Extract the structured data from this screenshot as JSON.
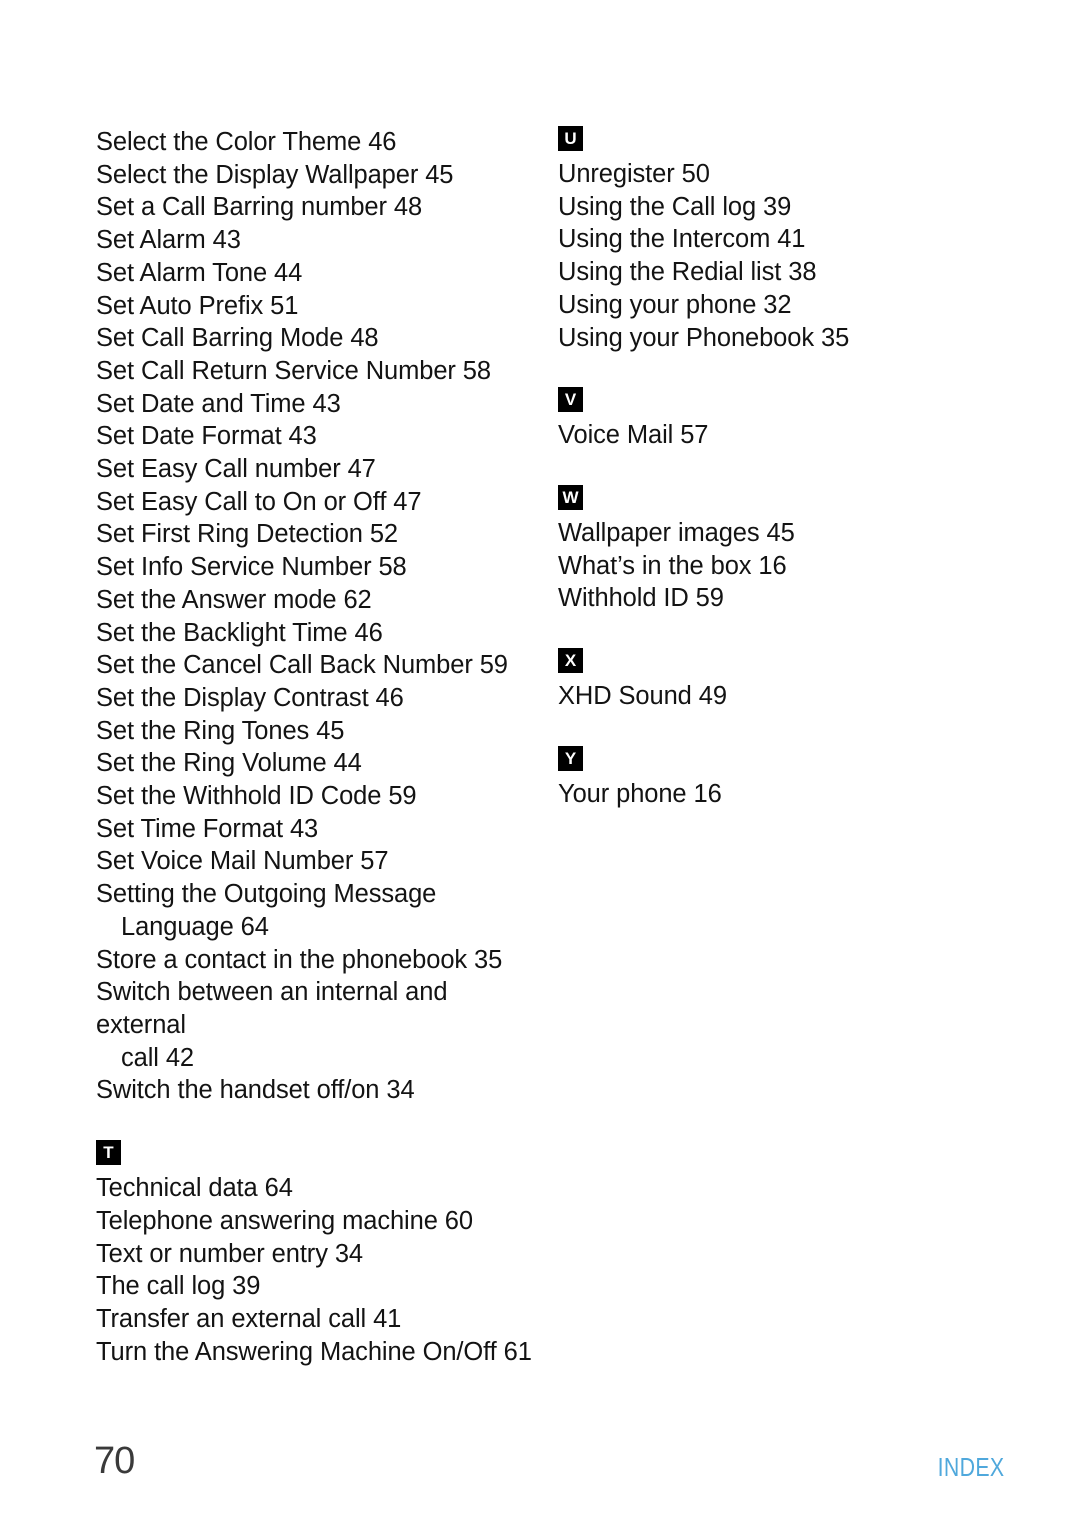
{
  "document": {
    "page_number": "70",
    "footer_label": "INDEX",
    "footer_label_color": "#4FA8DC",
    "badge_background_color": "#000000",
    "badge_text_color": "#FFFFFF",
    "text_color": "#131313"
  },
  "index": {
    "left_column": [
      {
        "letter": null,
        "entries": [
          {
            "text": "Select the Color Theme 46"
          },
          {
            "text": "Select the Display Wallpaper 45"
          },
          {
            "text": "Set a Call Barring number 48"
          },
          {
            "text": "Set Alarm 43"
          },
          {
            "text": "Set Alarm Tone 44"
          },
          {
            "text": "Set Auto Prefix 51"
          },
          {
            "text": "Set Call Barring Mode 48"
          },
          {
            "text": "Set Call Return Service Number 58"
          },
          {
            "text": "Set Date and Time 43"
          },
          {
            "text": "Set Date Format 43"
          },
          {
            "text": "Set Easy Call number 47"
          },
          {
            "text": "Set Easy Call to On or Off 47"
          },
          {
            "text": "Set First Ring Detection 52"
          },
          {
            "text": "Set Info Service Number 58"
          },
          {
            "text": "Set the Answer mode 62"
          },
          {
            "text": "Set the Backlight Time 46"
          },
          {
            "text": "Set the Cancel Call Back Number 59"
          },
          {
            "text": "Set the Display Contrast 46"
          },
          {
            "text": "Set the Ring Tones 45"
          },
          {
            "text": "Set the Ring Volume 44"
          },
          {
            "text": "Set the Withhold ID Code 59"
          },
          {
            "text": "Set Time Format 43"
          },
          {
            "text": "Set Voice Mail Number 57"
          },
          {
            "text": "Setting the Outgoing Message",
            "continuation": "Language 64"
          },
          {
            "text": "Store a contact in the phonebook 35"
          },
          {
            "text": "Switch between an internal and external",
            "continuation": "call 42"
          },
          {
            "text": "Switch the handset off/on 34"
          }
        ]
      },
      {
        "letter": "T",
        "entries": [
          {
            "text": "Technical data 64"
          },
          {
            "text": "Telephone answering machine 60"
          },
          {
            "text": "Text or number entry 34"
          },
          {
            "text": "The call log 39"
          },
          {
            "text": "Transfer an external call 41"
          },
          {
            "text": "Turn the Answering Machine On/Off 61"
          }
        ]
      }
    ],
    "right_column": [
      {
        "letter": "U",
        "entries": [
          {
            "text": "Unregister 50"
          },
          {
            "text": "Using the Call log 39"
          },
          {
            "text": "Using the Intercom 41"
          },
          {
            "text": "Using the Redial list 38"
          },
          {
            "text": "Using your phone 32"
          },
          {
            "text": "Using your Phonebook 35"
          }
        ]
      },
      {
        "letter": "V",
        "entries": [
          {
            "text": "Voice Mail 57"
          }
        ]
      },
      {
        "letter": "W",
        "entries": [
          {
            "text": "Wallpaper images 45"
          },
          {
            "text": "What’s in the box 16"
          },
          {
            "text": "Withhold ID 59"
          }
        ]
      },
      {
        "letter": "X",
        "entries": [
          {
            "text": "XHD Sound 49"
          }
        ]
      },
      {
        "letter": "Y",
        "entries": [
          {
            "text": "Your phone 16"
          }
        ]
      }
    ]
  }
}
